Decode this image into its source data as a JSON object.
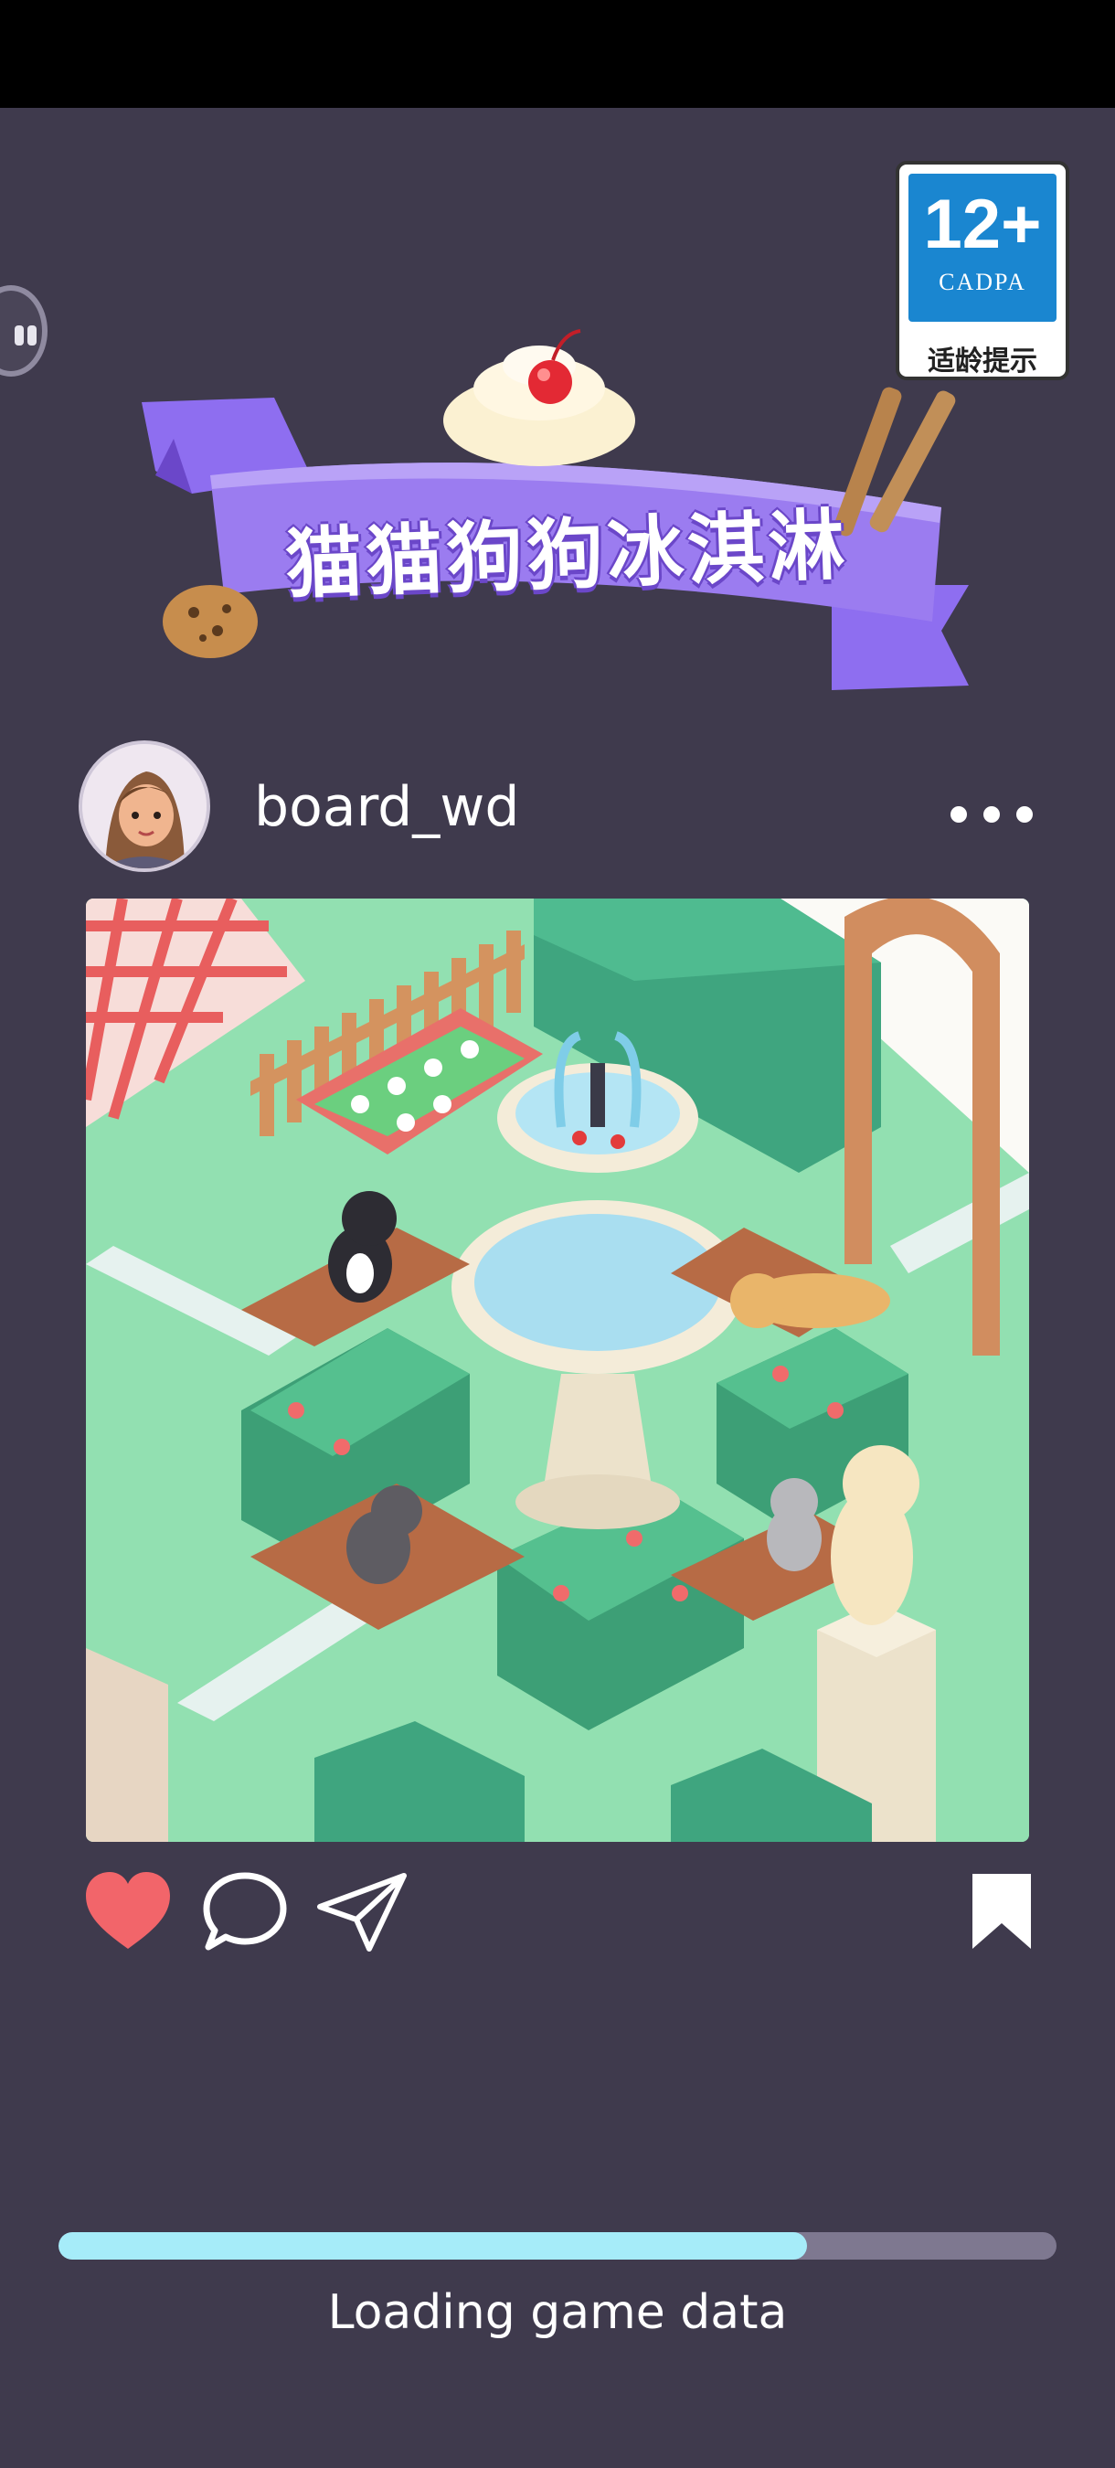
{
  "age_rating": {
    "rating": "12+",
    "org": "CADPA",
    "note": "适龄提示"
  },
  "game_title": "猫猫狗狗冰淇淋",
  "profile": {
    "username": "board_wd"
  },
  "loading": {
    "text": "Loading game data",
    "progress": 0.75
  },
  "icons": [
    "pause-icon",
    "more-icon",
    "heart-icon",
    "comment-icon",
    "share-icon",
    "bookmark-icon"
  ],
  "colors": {
    "background": "#3f3a4d",
    "progress": "#a6ecf9",
    "heart": "#f2656a",
    "banner": "#9b7cf0"
  }
}
